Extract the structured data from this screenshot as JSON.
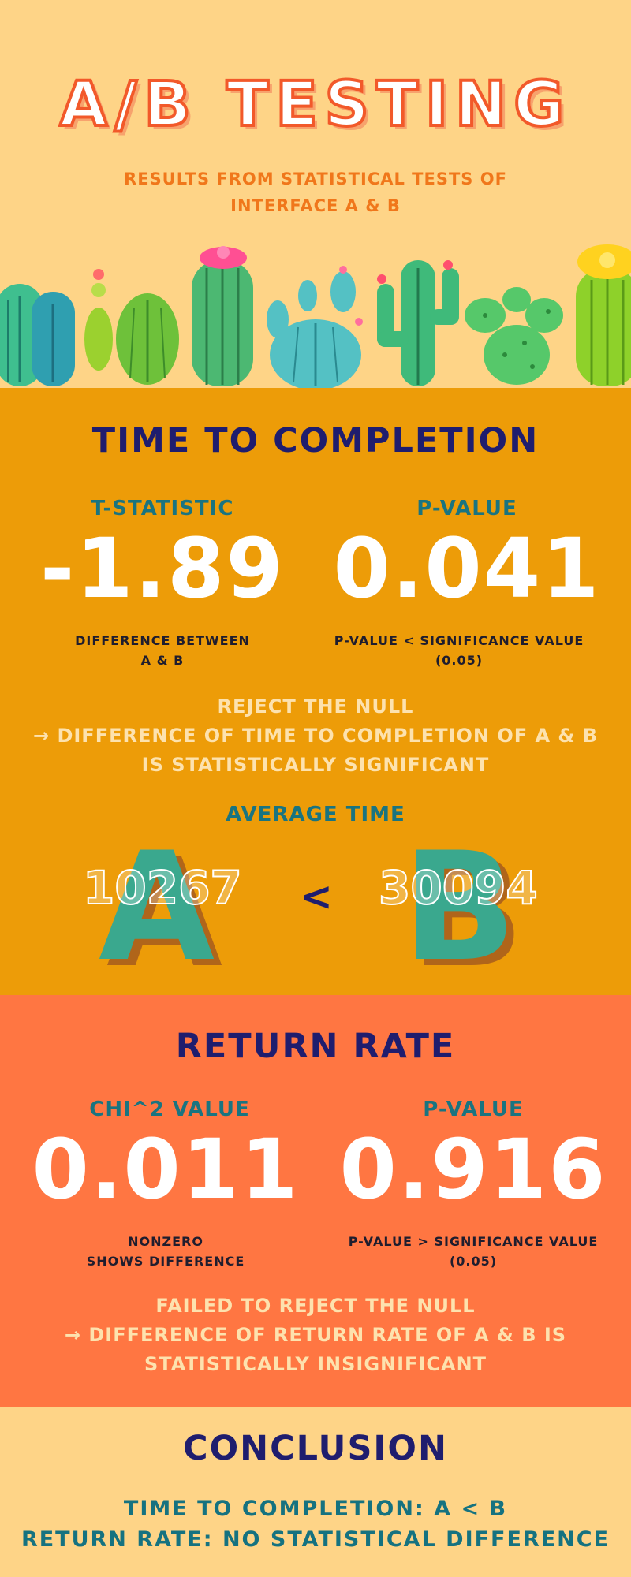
{
  "header": {
    "title": "A/B TESTING",
    "subtitle_line1": "RESULTS FROM STATISTICAL TESTS OF",
    "subtitle_line2": "INTERFACE A & B"
  },
  "time_section": {
    "title": "TIME TO COMPLETION",
    "left_label": "T-STATISTIC",
    "left_value": "-1.89",
    "left_note_line1": "DIFFERENCE BETWEEN",
    "left_note_line2": "A & B",
    "right_label": "P-VALUE",
    "right_value": "0.041",
    "right_note_line1": "P-VALUE < SIGNIFICANCE VALUE",
    "right_note_line2": "(0.05)",
    "verdict_line1": "REJECT THE NULL",
    "verdict_line2": "→ DIFFERENCE OF TIME TO COMPLETION OF A & B",
    "verdict_line3": "IS  STATISTICALLY SIGNIFICANT",
    "avg_title": "AVERAGE TIME",
    "letter_a": "A",
    "letter_b": "B",
    "avg_a": "10267",
    "comparison": "<",
    "avg_b": "30094"
  },
  "return_section": {
    "title": "RETURN RATE",
    "left_label": "CHI^2 VALUE",
    "left_value": "0.011",
    "left_note_line1": "NONZERO",
    "left_note_line2": "SHOWS DIFFERENCE",
    "right_label": "P-VALUE",
    "right_value": "0.916",
    "right_note_line1": "P-VALUE > SIGNIFICANCE VALUE",
    "right_note_line2": "(0.05)",
    "verdict_line1": "FAILED TO REJECT THE NULL",
    "verdict_line2": "→ DIFFERENCE OF RETURN RATE OF A & B IS",
    "verdict_line3": "STATISTICALLY INSIGNIFICANT"
  },
  "conclusion": {
    "title": "CONCLUSION",
    "line1": "TIME TO COMPLETION: A < B",
    "line2": "RETURN RATE: NO STATISTICAL DIFFERENCE"
  },
  "colors": {
    "background": "#fed487",
    "time_section": "#ed9c08",
    "return_section": "#ff7642",
    "navy": "#1f1d6e",
    "teal": "#1a7480",
    "title_outline": "#f2592a"
  }
}
